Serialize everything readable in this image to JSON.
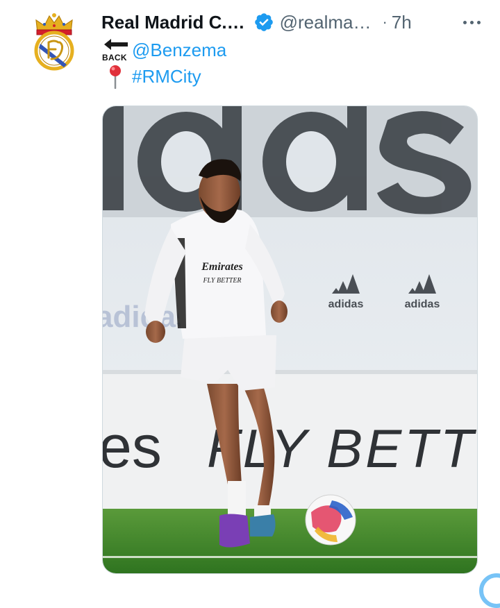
{
  "tweet": {
    "display_name": "Real Madrid C.…",
    "handle": "@realma…",
    "separator": "·",
    "time": "7h",
    "emoji_back_label": "BACK",
    "mention": "@Benzema",
    "hashtag": "#RMCity",
    "media": {
      "wall_text": "ıdas",
      "banner_text_left": "es",
      "banner_text_right": "FLY BETTER",
      "brand_logo_text": "adidas",
      "shirt_sponsor_line1": "Emirates",
      "shirt_sponsor_line2": "FLY BETTER"
    }
  },
  "colors": {
    "link": "#1d9bf0",
    "verified": "#1d9bf0",
    "muted": "#536471",
    "text": "#0f1419",
    "border": "#cfd9de",
    "pitch": "#3f8a2a"
  },
  "icons": {
    "verified": "verified-badge-icon",
    "more": "more-icon",
    "back_arrow": "back-arrow-emoji",
    "pin": "round-pushpin-emoji"
  }
}
